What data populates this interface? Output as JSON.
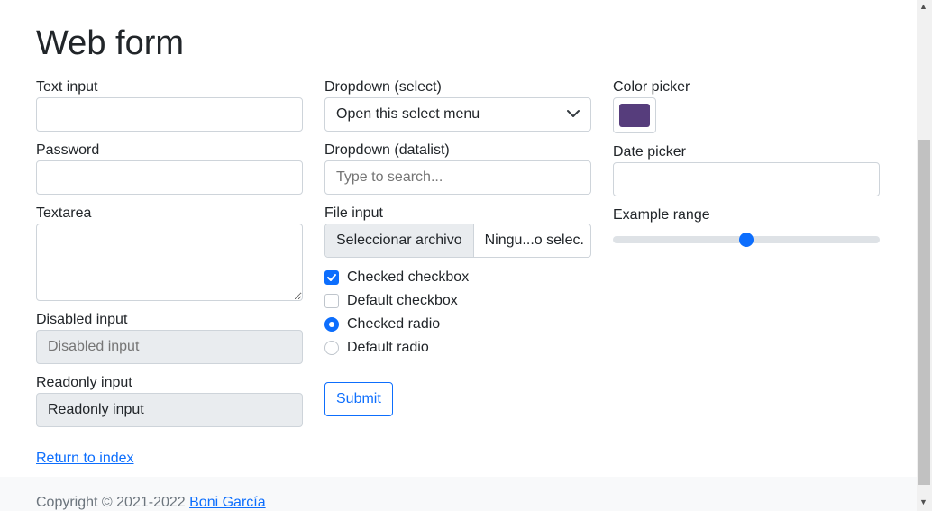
{
  "page": {
    "title": "Web form"
  },
  "fields": {
    "text_input_label": "Text input",
    "password_label": "Password",
    "textarea_label": "Textarea",
    "disabled_label": "Disabled input",
    "disabled_placeholder": "Disabled input",
    "readonly_label": "Readonly input",
    "readonly_value": "Readonly input",
    "select_label": "Dropdown (select)",
    "select_value": "Open this select menu",
    "datalist_label": "Dropdown (datalist)",
    "datalist_placeholder": "Type to search...",
    "file_label": "File input",
    "file_button": "Seleccionar archivo",
    "file_name": "Ningu...o selec.",
    "checkbox_checked_label": "Checked checkbox",
    "checkbox_default_label": "Default checkbox",
    "radio_checked_label": "Checked radio",
    "radio_default_label": "Default radio",
    "submit_label": "Submit",
    "color_label": "Color picker",
    "color_value": "#563d7c",
    "date_label": "Date picker",
    "range_label": "Example range",
    "range_value": 0.5
  },
  "links": {
    "return": "Return to index"
  },
  "footer": {
    "copyright": "Copyright © 2021-2022",
    "author": "Boni García"
  },
  "colors": {
    "accent": "#0d6efd"
  }
}
